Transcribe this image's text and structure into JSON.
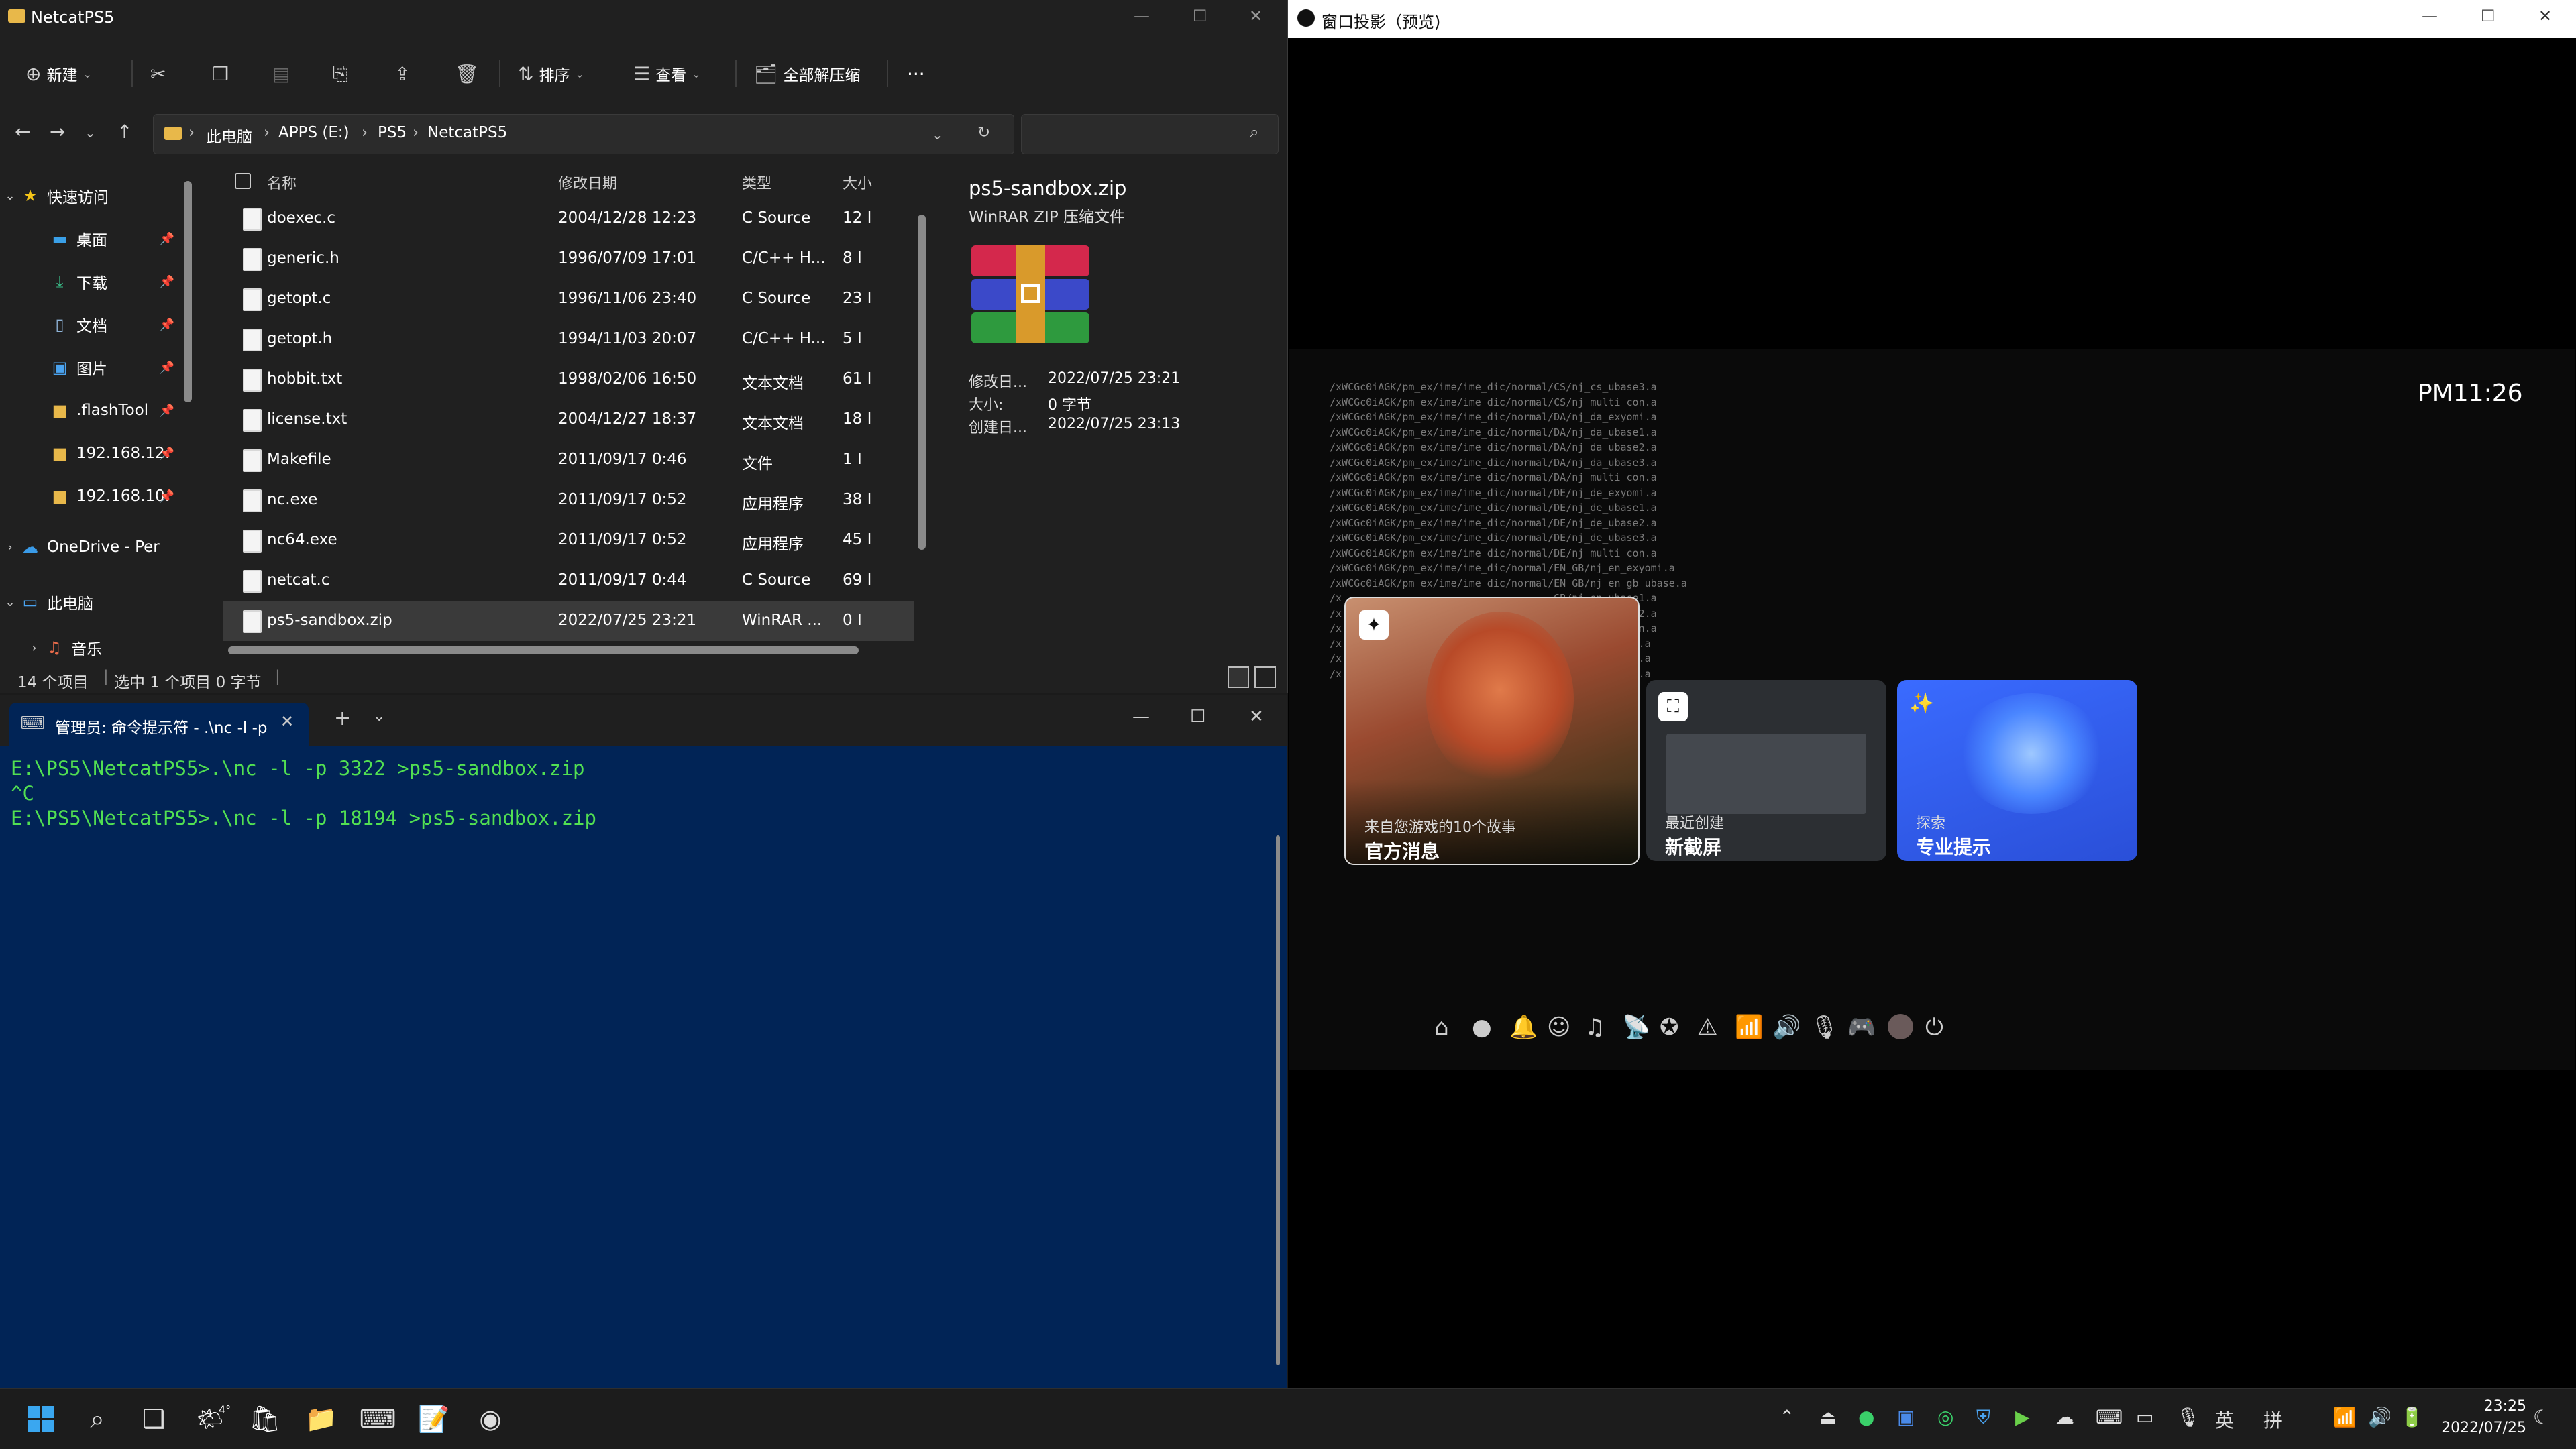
{
  "explorer": {
    "title": "NetcatPS5",
    "win_controls": [
      "—",
      "☐",
      "✕"
    ],
    "toolbar": {
      "new": "新建",
      "sort": "排序",
      "view": "查看",
      "extract_all": "全部解压缩",
      "more": "···"
    },
    "address": {
      "crumbs": [
        "此电脑",
        "APPS (E:)",
        "PS5",
        "NetcatPS5"
      ]
    },
    "nav": {
      "quick_access": "快速访问",
      "items": [
        "桌面",
        "下载",
        "文档",
        "图片",
        ".flashTool",
        "192.168.12:",
        "192.168.10."
      ],
      "onedrive": "OneDrive - Per",
      "this_pc": "此电脑",
      "music": "音乐"
    },
    "columns": {
      "name": "名称",
      "date": "修改日期",
      "type": "类型",
      "size": "大小"
    },
    "files": [
      {
        "name": "doexec.c",
        "date": "2004/12/28 12:23",
        "type": "C Source",
        "size": "12 I"
      },
      {
        "name": "generic.h",
        "date": "1996/07/09 17:01",
        "type": "C/C++ H...",
        "size": "8 I"
      },
      {
        "name": "getopt.c",
        "date": "1996/11/06 23:40",
        "type": "C Source",
        "size": "23 I"
      },
      {
        "name": "getopt.h",
        "date": "1994/11/03 20:07",
        "type": "C/C++ H...",
        "size": "5 I"
      },
      {
        "name": "hobbit.txt",
        "date": "1998/02/06 16:50",
        "type": "文本文档",
        "size": "61 I"
      },
      {
        "name": "license.txt",
        "date": "2004/12/27 18:37",
        "type": "文本文档",
        "size": "18 I"
      },
      {
        "name": "Makefile",
        "date": "2011/09/17 0:46",
        "type": "文件",
        "size": "1 I"
      },
      {
        "name": "nc.exe",
        "date": "2011/09/17 0:52",
        "type": "应用程序",
        "size": "38 I"
      },
      {
        "name": "nc64.exe",
        "date": "2011/09/17 0:52",
        "type": "应用程序",
        "size": "45 I"
      },
      {
        "name": "netcat.c",
        "date": "2011/09/17 0:44",
        "type": "C Source",
        "size": "69 I"
      },
      {
        "name": "ps5-sandbox.zip",
        "date": "2022/07/25 23:21",
        "type": "WinRAR ...",
        "size": "0 I"
      }
    ],
    "preview": {
      "filename": "ps5-sandbox.zip",
      "filetype": "WinRAR ZIP 压缩文件",
      "modified_label": "修改日...",
      "modified": "2022/07/25 23:21",
      "size_label": "大小:",
      "size": "0 字节",
      "created_label": "创建日...",
      "created": "2022/07/25 23:13"
    },
    "status": {
      "count": "14 个项目",
      "selected": "选中 1 个项目  0 字节"
    }
  },
  "terminal": {
    "tab_title": "管理员: 命令提示符 - .\\nc  -l -p",
    "lines": [
      "E:\\PS5\\NetcatPS5>.\\nc -l -p 3322 >ps5-sandbox.zip",
      "^C",
      "E:\\PS5\\NetcatPS5>.\\nc -l -p 18194 >ps5-sandbox.zip"
    ]
  },
  "projector": {
    "title": "窗口投影（预览)",
    "time": "PM11:26",
    "log": [
      "/xWCGc0iAGK/pm_ex/ime/ime_dic/normal/CS/nj_cs_ubase3.a",
      "/xWCGc0iAGK/pm_ex/ime/ime_dic/normal/CS/nj_multi_con.a",
      "/xWCGc0iAGK/pm_ex/ime/ime_dic/normal/DA/nj_da_exyomi.a",
      "/xWCGc0iAGK/pm_ex/ime/ime_dic/normal/DA/nj_da_ubase1.a",
      "/xWCGc0iAGK/pm_ex/ime/ime_dic/normal/DA/nj_da_ubase2.a",
      "/xWCGc0iAGK/pm_ex/ime/ime_dic/normal/DA/nj_da_ubase3.a",
      "/xWCGc0iAGK/pm_ex/ime/ime_dic/normal/DA/nj_multi_con.a",
      "/xWCGc0iAGK/pm_ex/ime/ime_dic/normal/DE/nj_de_exyomi.a",
      "/xWCGc0iAGK/pm_ex/ime/ime_dic/normal/DE/nj_de_ubase1.a",
      "/xWCGc0iAGK/pm_ex/ime/ime_dic/normal/DE/nj_de_ubase2.a",
      "/xWCGc0iAGK/pm_ex/ime/ime_dic/normal/DE/nj_de_ubase3.a",
      "/xWCGc0iAGK/pm_ex/ime/ime_dic/normal/DE/nj_multi_con.a",
      "/xWCGc0iAGK/pm_ex/ime/ime_dic/normal/EN_GB/nj_en_exyomi.a",
      "/xWCGc0iAGK/pm_ex/ime/ime_dic/normal/EN_GB/nj_en_gb_ubase.a",
      "/x                                   GB/nj_en_ubase1.a",
      "/x                                   GB/nj_en_ubase2.a",
      "/x                                   GB/nj_multi_con.a",
      "/x                                   S/nj_en_exyomi.a",
      "/x                                   S/nj_en_ubase1.a",
      "/x                                   S/nj_en_ubase2.a"
    ],
    "cards": [
      {
        "sub": "来自您游戏的10个故事",
        "title": "官方消息"
      },
      {
        "sub": "最近创建",
        "title": "新截屏"
      },
      {
        "sub": "探索",
        "title": "专业提示"
      }
    ],
    "icons": [
      "home-icon",
      "game-icon",
      "bell-icon",
      "friends-icon",
      "music-icon",
      "broadcast-icon",
      "accessibility-icon",
      "trophy-icon",
      "network-icon",
      "volume-icon",
      "mic-mute-icon",
      "controller-icon",
      "profile-avatar",
      "power-icon"
    ]
  },
  "taskbar": {
    "time": "23:25",
    "date": "2022/07/25",
    "ime_lang": "英",
    "ime_mode": "拼",
    "weather_temp": "4°"
  },
  "colors": {
    "terminal_bg": "#012456",
    "terminal_text": "#52e052",
    "explorer_bg": "#202020",
    "tip_card": "#3b6cff"
  }
}
